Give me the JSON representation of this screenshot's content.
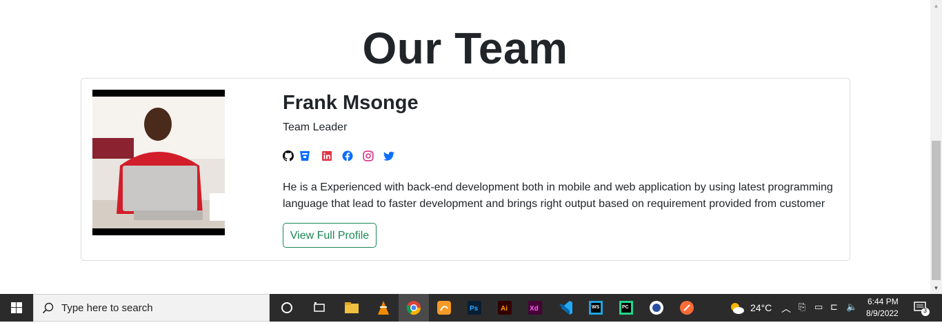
{
  "page": {
    "title": "Our Team"
  },
  "member": {
    "name": "Frank Msonge",
    "role": "Team Leader",
    "bio": "He is a Experienced with back-end development both in mobile and web application by using latest programming language that lead to faster development and brings right output based on requirement provided from customer",
    "button_label": "View Full Profile",
    "socials": [
      "github-icon",
      "bitbucket-icon",
      "linkedin-icon",
      "facebook-icon",
      "instagram-icon",
      "twitter-icon"
    ]
  },
  "taskbar": {
    "search_placeholder": "Type here to search",
    "apps": [
      "task-view",
      "file-explorer",
      "vlc",
      "chrome",
      "uc-browser",
      "photoshop",
      "illustrator",
      "xd",
      "vscode",
      "webstorm",
      "pycharm",
      "app-icon",
      "postman-like"
    ],
    "weather": "24°C",
    "time": "6:44 PM",
    "date": "8/9/2022",
    "notifications": "3"
  },
  "colors": {
    "button_green": "#198754",
    "text": "#212529",
    "taskbar": "#2b2b2b"
  }
}
